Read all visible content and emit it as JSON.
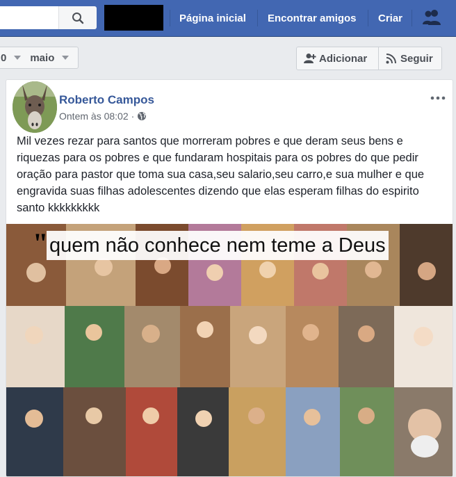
{
  "topbar": {
    "nav": [
      {
        "label": "Página inicial"
      },
      {
        "label": "Encontrar amigos"
      },
      {
        "label": "Criar"
      }
    ]
  },
  "subbar": {
    "year_fragment": "0",
    "month": "maio",
    "add_label": "Adicionar",
    "follow_label": "Seguir"
  },
  "post": {
    "author": "Roberto Campos",
    "timestamp": "Ontem às 08:02",
    "separator": "·",
    "privacy_icon": "globe-icon",
    "text": "Mil vezes rezar para santos que morreram pobres e que deram seus bens e riquezas para os pobres e que fundaram hospitais para os pobres do que pedir oração para pastor que toma sua casa,seu salario,seu carro,e sua mulher e que engravida suas filhas adolescentes dizendo que elas esperam filhas do espirito santo kkkkkkkkk",
    "image": {
      "caption": "quem não conhece nem teme a Deus",
      "quote": "\""
    }
  },
  "colors": {
    "brand": "#4267b2",
    "link": "#365899",
    "text": "#1d2129",
    "muted": "#616770"
  }
}
